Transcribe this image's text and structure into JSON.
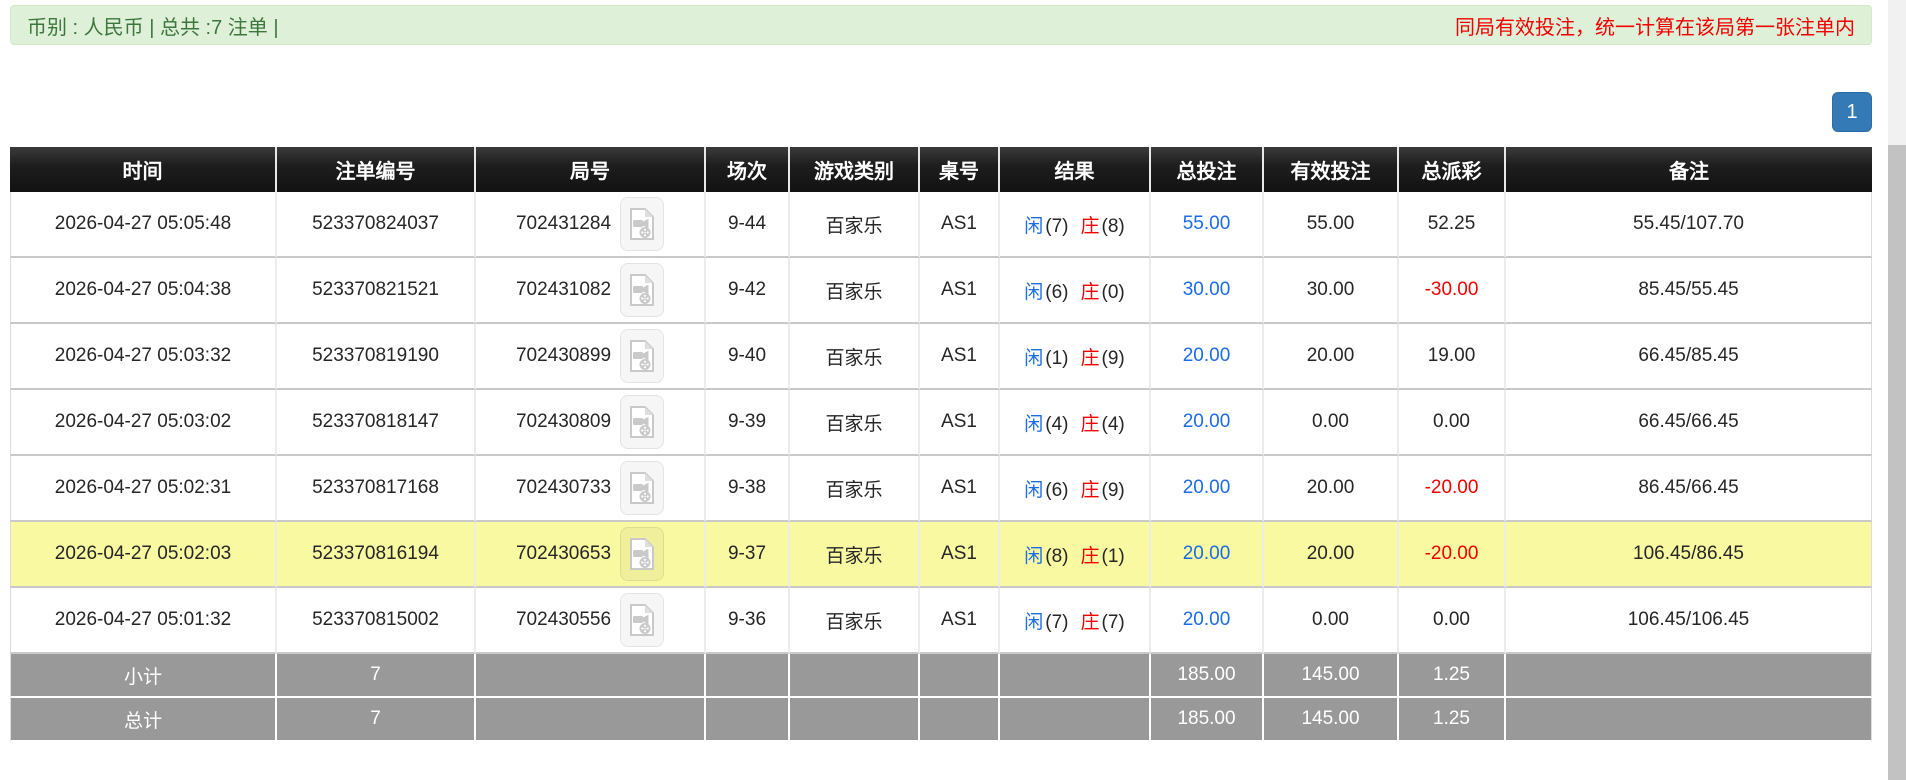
{
  "topbar": {
    "left_text": "币别 : 人民币 | 总共 :7 注单 |",
    "right_note": "同局有效投注，统一计算在该局第一张注单内"
  },
  "pagination": {
    "current_page": "1"
  },
  "table": {
    "headers": [
      "时间",
      "注单编号",
      "局号",
      "场次",
      "游戏类别",
      "桌号",
      "结果",
      "总投注",
      "有效投注",
      "总派彩",
      "备注"
    ],
    "rows": [
      {
        "time": "2026-04-27 05:05:48",
        "bet_id": "523370824037",
        "round_id": "702431284",
        "session": "9-44",
        "game_type": "百家乐",
        "table_no": "AS1",
        "result": {
          "player_label": "闲",
          "player": "(7)",
          "banker_label": "庄",
          "banker": "(8)"
        },
        "total_bet": "55.00",
        "valid_bet": "55.00",
        "payout": "52.25",
        "remark": "55.45/107.70",
        "highlighted": false
      },
      {
        "time": "2026-04-27 05:04:38",
        "bet_id": "523370821521",
        "round_id": "702431082",
        "session": "9-42",
        "game_type": "百家乐",
        "table_no": "AS1",
        "result": {
          "player_label": "闲",
          "player": "(6)",
          "banker_label": "庄",
          "banker": "(0)"
        },
        "total_bet": "30.00",
        "valid_bet": "30.00",
        "payout": "-30.00",
        "remark": "85.45/55.45",
        "highlighted": false
      },
      {
        "time": "2026-04-27 05:03:32",
        "bet_id": "523370819190",
        "round_id": "702430899",
        "session": "9-40",
        "game_type": "百家乐",
        "table_no": "AS1",
        "result": {
          "player_label": "闲",
          "player": "(1)",
          "banker_label": "庄",
          "banker": "(9)"
        },
        "total_bet": "20.00",
        "valid_bet": "20.00",
        "payout": "19.00",
        "remark": "66.45/85.45",
        "highlighted": false
      },
      {
        "time": "2026-04-27 05:03:02",
        "bet_id": "523370818147",
        "round_id": "702430809",
        "session": "9-39",
        "game_type": "百家乐",
        "table_no": "AS1",
        "result": {
          "player_label": "闲",
          "player": "(4)",
          "banker_label": "庄",
          "banker": "(4)"
        },
        "total_bet": "20.00",
        "valid_bet": "0.00",
        "payout": "0.00",
        "remark": "66.45/66.45",
        "highlighted": false
      },
      {
        "time": "2026-04-27 05:02:31",
        "bet_id": "523370817168",
        "round_id": "702430733",
        "session": "9-38",
        "game_type": "百家乐",
        "table_no": "AS1",
        "result": {
          "player_label": "闲",
          "player": "(6)",
          "banker_label": "庄",
          "banker": "(9)"
        },
        "total_bet": "20.00",
        "valid_bet": "20.00",
        "payout": "-20.00",
        "remark": "86.45/66.45",
        "highlighted": false
      },
      {
        "time": "2026-04-27 05:02:03",
        "bet_id": "523370816194",
        "round_id": "702430653",
        "session": "9-37",
        "game_type": "百家乐",
        "table_no": "AS1",
        "result": {
          "player_label": "闲",
          "player": "(8)",
          "banker_label": "庄",
          "banker": "(1)"
        },
        "total_bet": "20.00",
        "valid_bet": "20.00",
        "payout": "-20.00",
        "remark": "106.45/86.45",
        "highlighted": true
      },
      {
        "time": "2026-04-27 05:01:32",
        "bet_id": "523370815002",
        "round_id": "702430556",
        "session": "9-36",
        "game_type": "百家乐",
        "table_no": "AS1",
        "result": {
          "player_label": "闲",
          "player": "(7)",
          "banker_label": "庄",
          "banker": "(7)"
        },
        "total_bet": "20.00",
        "valid_bet": "0.00",
        "payout": "0.00",
        "remark": "106.45/106.45",
        "highlighted": false
      }
    ],
    "summary_rows": [
      {
        "label": "小计",
        "count": "7",
        "total_bet": "185.00",
        "valid_bet": "145.00",
        "payout": "1.25"
      },
      {
        "label": "总计",
        "count": "7",
        "total_bet": "185.00",
        "valid_bet": "145.00",
        "payout": "1.25"
      }
    ]
  },
  "icons": {
    "round_cell_icon": "video-file-icon"
  },
  "colors": {
    "player_blue": "#1a6ce8",
    "banker_red": "#f30000",
    "negative_red": "#f30000",
    "highlight_yellow": "#f9f9a2",
    "header_bg": "#1c1c1c",
    "summary_gray": "#999999",
    "alert_bg": "#dff0d8",
    "alert_text_green": "#3c763d",
    "alert_note_red": "#f30000",
    "pagination_blue": "#337ab7"
  }
}
